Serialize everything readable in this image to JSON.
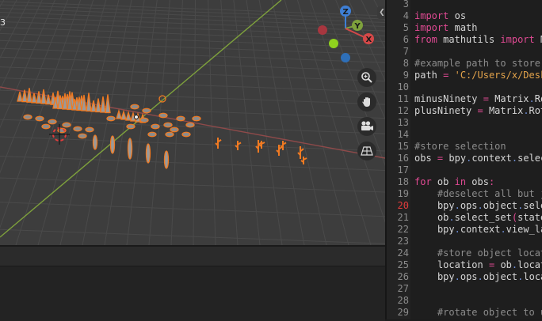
{
  "viewport": {
    "stub_text": "3",
    "gizmo": {
      "z": "Z",
      "y": "Y",
      "x": "X"
    },
    "nav_buttons": [
      "zoom-icon",
      "hand-icon",
      "camera-icon",
      "grid-icon"
    ],
    "colors": {
      "background": "#3d3d3d",
      "grid": "#4a4a4a",
      "x_axis": "#8e4a4a",
      "y_axis": "#7ea13c",
      "selection": "#f07a22"
    }
  },
  "editor": {
    "lines": [
      {
        "n": "3",
        "code": ""
      },
      {
        "n": "4",
        "code": "import os"
      },
      {
        "n": "5",
        "code": "import math"
      },
      {
        "n": "6",
        "code": "from mathutils import M"
      },
      {
        "n": "7",
        "code": ""
      },
      {
        "n": "8",
        "code": "#example path to store"
      },
      {
        "n": "9",
        "code": "path = 'C:/Users/x/Desk"
      },
      {
        "n": "10",
        "code": ""
      },
      {
        "n": "11",
        "code": "minusNinety = Matrix.Ro"
      },
      {
        "n": "12",
        "code": "plusNinety = Matrix.Rot"
      },
      {
        "n": "13",
        "code": ""
      },
      {
        "n": "14",
        "code": ""
      },
      {
        "n": "15",
        "code": "#store selection"
      },
      {
        "n": "16",
        "code": "obs = bpy.context.selec"
      },
      {
        "n": "17",
        "code": ""
      },
      {
        "n": "18",
        "code": "for ob in obs:"
      },
      {
        "n": "19",
        "code": "    #deselect all but j"
      },
      {
        "n": "20",
        "code": "    bpy.ops.object.sele"
      },
      {
        "n": "21",
        "code": "    ob.select_set(state"
      },
      {
        "n": "22",
        "code": "    bpy.context.view_la"
      },
      {
        "n": "23",
        "code": ""
      },
      {
        "n": "24",
        "code": "    #store object locat"
      },
      {
        "n": "25",
        "code": "    location = ob.locat"
      },
      {
        "n": "26",
        "code": "    bpy.ops.object.loca"
      },
      {
        "n": "27",
        "code": ""
      },
      {
        "n": "28",
        "code": ""
      },
      {
        "n": "29",
        "code": "    #rotate object to u"
      }
    ],
    "error_line": "20"
  }
}
